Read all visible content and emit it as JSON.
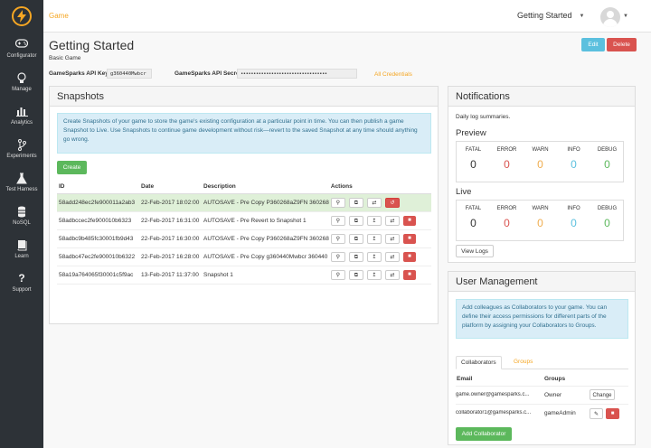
{
  "sidebar": {
    "items": [
      {
        "label": "Configurator",
        "icon": "gamepad-icon"
      },
      {
        "label": "Manage",
        "icon": "lightbulb-icon"
      },
      {
        "label": "Analytics",
        "icon": "bar-chart-icon"
      },
      {
        "label": "Experiments",
        "icon": "branch-icon"
      },
      {
        "label": "Test Harness",
        "icon": "flask-icon"
      },
      {
        "label": "NoSQL",
        "icon": "database-icon"
      },
      {
        "label": "Learn",
        "icon": "book-icon"
      },
      {
        "label": "Support",
        "icon": "question-icon"
      }
    ]
  },
  "topbar": {
    "breadcrumb": "Game",
    "game_select": "Getting Started"
  },
  "page": {
    "title": "Getting Started",
    "subtitle": "Basic Game",
    "edit_label": "Edit",
    "delete_label": "Delete",
    "api_key_label": "GameSparks API Key",
    "api_key_value": "g360440Mwbcr",
    "api_secret_label": "GameSparks API Secret",
    "api_secret_value": "••••••••••••••••••••••••••••••••••",
    "all_credentials": "All Credentials"
  },
  "snapshots": {
    "title": "Snapshots",
    "info": "Create Snapshots of your game to store the game's existing configuration at a particular point in time. You can then publish a game Snapshot to Live. Use Snapshots to continue game development without risk—revert to the saved Snapshot at any time should anything go wrong.",
    "create_label": "Create",
    "columns": [
      "ID",
      "Date",
      "Description",
      "Actions"
    ],
    "rows": [
      {
        "id": "58add248ec2fe900011a2ab3",
        "date": "22-Feb-2017 18:02:00",
        "desc": "AUTOSAVE - Pre Copy P360268aZ9FN 360268"
      },
      {
        "id": "58adbccec2fe900010b6323",
        "date": "22-Feb-2017 16:31:00",
        "desc": "AUTOSAVE - Pre Revert to Snapshot 1"
      },
      {
        "id": "58adbc9b485fc30001fb9d43",
        "date": "22-Feb-2017 16:30:00",
        "desc": "AUTOSAVE - Pre Copy P360268aZ9FN 360268"
      },
      {
        "id": "58adbc47ec2fe900010b6322",
        "date": "22-Feb-2017 16:28:00",
        "desc": "AUTOSAVE - Pre Copy g360440Mwbcr 360440"
      },
      {
        "id": "58a19a764065f30001c5f9ac",
        "date": "13-Feb-2017 11:37:00",
        "desc": "Snapshot 1"
      }
    ]
  },
  "notifications": {
    "title": "Notifications",
    "subtitle": "Daily log summaries.",
    "preview_title": "Preview",
    "live_title": "Live",
    "levels": [
      {
        "name": "FATAL",
        "color": "#333333"
      },
      {
        "name": "ERROR",
        "color": "#d9534f"
      },
      {
        "name": "WARN",
        "color": "#f0ad4e"
      },
      {
        "name": "INFO",
        "color": "#5bc0de"
      },
      {
        "name": "DEBUG",
        "color": "#5cb85c"
      }
    ],
    "preview_counts": [
      "0",
      "0",
      "0",
      "0",
      "0"
    ],
    "live_counts": [
      "0",
      "0",
      "0",
      "0",
      "0"
    ],
    "view_logs_label": "View Logs"
  },
  "user_management": {
    "title": "User Management",
    "info": "Add colleagues as Collaborators to your game. You can define their access permissions for different parts of the platform by assigning your Collaborators to Groups.",
    "tab_collaborators": "Collaborators",
    "tab_groups": "Groups",
    "col_email": "Email",
    "col_groups": "Groups",
    "rows": [
      {
        "email": "game.owner@gamesparks.c...",
        "group": "Owner",
        "action": "Change"
      },
      {
        "email": "collaborator1@gamesparks.c...",
        "group": "gameAdmin"
      }
    ],
    "add_label": "Add Collaborator"
  }
}
